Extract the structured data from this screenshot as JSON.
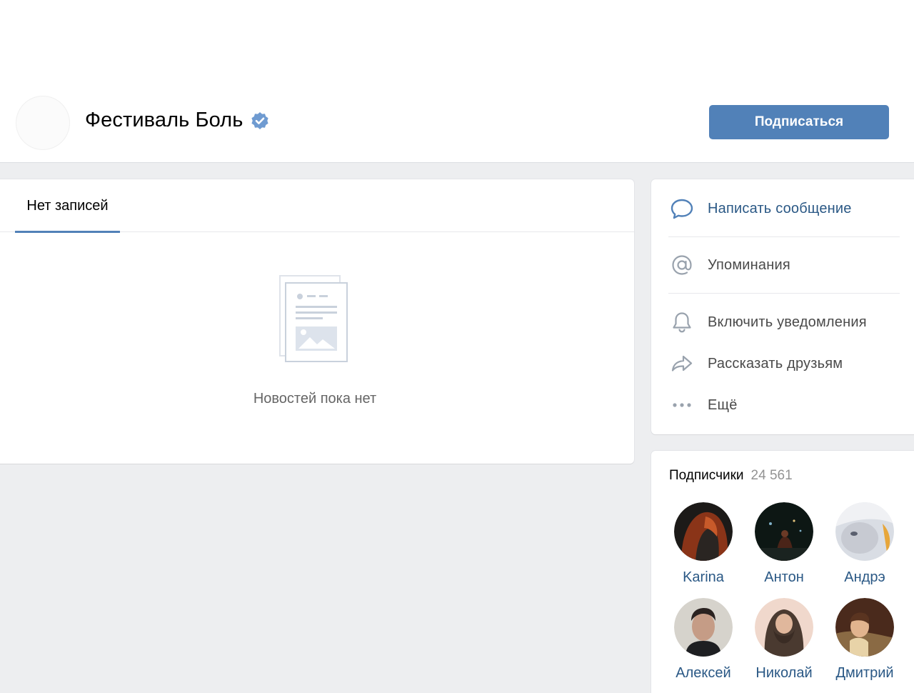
{
  "header": {
    "title": "Фестиваль Боль",
    "verified_icon": "verified-check-icon",
    "subscribe_label": "Подписаться",
    "accent_color": "#5181b8"
  },
  "wall": {
    "tab_label": "Нет записей",
    "empty_icon": "news-document-icon",
    "empty_text": "Новостей пока нет"
  },
  "actions": [
    {
      "label": "Написать сообщение",
      "icon": "message-bubble-icon"
    },
    {
      "label": "Упоминания",
      "icon": "at-sign-icon"
    },
    {
      "label": "Включить уведомления",
      "icon": "bell-icon"
    },
    {
      "label": "Рассказать друзьям",
      "icon": "share-arrow-icon"
    },
    {
      "label": "Ещё",
      "icon": "more-dots-icon"
    }
  ],
  "followers": {
    "title": "Подписчики",
    "count": "24 561",
    "people": [
      {
        "name": "Karina"
      },
      {
        "name": "Антон"
      },
      {
        "name": "Андрэ"
      },
      {
        "name": "Алексей"
      },
      {
        "name": "Николай"
      },
      {
        "name": "Дмитрий"
      }
    ]
  }
}
